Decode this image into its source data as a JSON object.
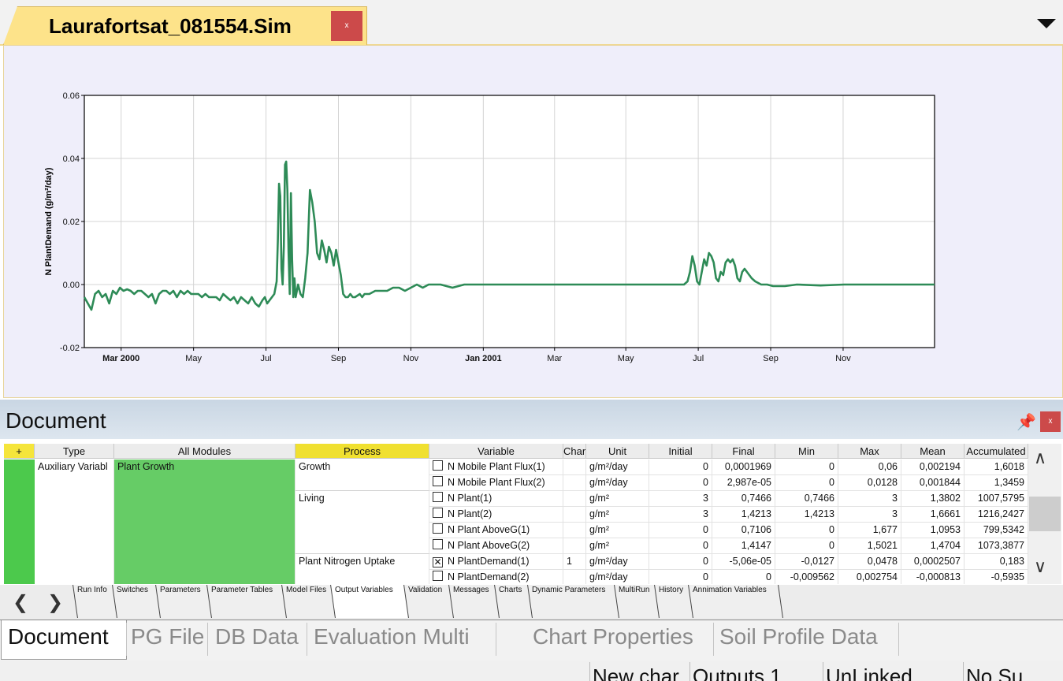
{
  "window": {
    "doc_tab_title": "Laurafortsat_081554.Sim",
    "close_glyph": "x"
  },
  "chart_data": {
    "type": "line",
    "title": "",
    "xlabel": "",
    "ylabel": "N PlantDemand (g/m²/day)",
    "ylim": [
      -0.02,
      0.06
    ],
    "yticks": [
      "-0.02",
      "0.00",
      "0.02",
      "0.04",
      "0.06"
    ],
    "xticks": [
      "Mar 2000",
      "May",
      "Jul",
      "Sep",
      "Nov",
      "Jan 2001",
      "Mar",
      "May",
      "Jul",
      "Sep",
      "Nov"
    ],
    "bold_xticks": [
      "Mar 2000",
      "Jan 2001"
    ],
    "x_range_days": [
      0,
      716
    ],
    "grid": true,
    "line_color": "#2e8b57",
    "series": [
      {
        "x_days": [
          0,
          3,
          6,
          9,
          12,
          15,
          18,
          21,
          24,
          27,
          30,
          33,
          36,
          39,
          42,
          45,
          48,
          51,
          54,
          57,
          60,
          63,
          66,
          69,
          72,
          75,
          78,
          81,
          84,
          87,
          90,
          93,
          96,
          99,
          102,
          105,
          108,
          111,
          114,
          117,
          120,
          123,
          126,
          129,
          132,
          135,
          138,
          141,
          144,
          147,
          150,
          152,
          154,
          156,
          158,
          160,
          162,
          163,
          164,
          165,
          166,
          167,
          168,
          169,
          170,
          171,
          172,
          173,
          174,
          175,
          176,
          177,
          178,
          180,
          182,
          184,
          186,
          188,
          190,
          192,
          194,
          196,
          198,
          200,
          202,
          204,
          206,
          208,
          210,
          212,
          214,
          216,
          218,
          220,
          222,
          224,
          226,
          228,
          230,
          232,
          234,
          236,
          240,
          245,
          250,
          255,
          260,
          265,
          270,
          275,
          280,
          285,
          290,
          295,
          300,
          310,
          320,
          330,
          340,
          350,
          360,
          370,
          380,
          390,
          400,
          410,
          420,
          430,
          440,
          450,
          460,
          470,
          480,
          490,
          500,
          505,
          508,
          510,
          512,
          514,
          516,
          518,
          520,
          522,
          524,
          526,
          528,
          530,
          532,
          534,
          536,
          538,
          540,
          542,
          544,
          546,
          548,
          550,
          552,
          554,
          556,
          558,
          560,
          562,
          565,
          570,
          575,
          580,
          590,
          600,
          620,
          640,
          660,
          680,
          700,
          716
        ],
        "y": [
          -0.004,
          -0.006,
          -0.008,
          -0.003,
          -0.002,
          -0.004,
          -0.003,
          -0.006,
          -0.002,
          -0.003,
          -0.001,
          -0.002,
          -0.0015,
          -0.002,
          -0.003,
          -0.002,
          -0.002,
          -0.003,
          -0.004,
          -0.003,
          -0.006,
          -0.003,
          -0.002,
          -0.002,
          -0.003,
          -0.002,
          -0.004,
          -0.002,
          -0.003,
          -0.002,
          -0.003,
          -0.003,
          -0.003,
          -0.004,
          -0.003,
          -0.004,
          -0.004,
          -0.004,
          -0.005,
          -0.003,
          -0.004,
          -0.005,
          -0.004,
          -0.006,
          -0.004,
          -0.005,
          -0.006,
          -0.004,
          -0.006,
          -0.007,
          -0.005,
          -0.004,
          -0.006,
          -0.005,
          -0.004,
          -0.003,
          0.001,
          0.014,
          0.032,
          0.028,
          0.005,
          0.0,
          0.012,
          0.038,
          0.039,
          0.03,
          0.01,
          -0.003,
          0.029,
          0.008,
          -0.004,
          0.002,
          -0.004,
          0.0,
          -0.003,
          -0.004,
          0.002,
          0.01,
          0.03,
          0.026,
          0.02,
          0.01,
          0.008,
          0.014,
          0.011,
          0.007,
          0.012,
          0.01,
          0.006,
          0.011,
          0.007,
          0.003,
          -0.003,
          -0.004,
          -0.004,
          -0.003,
          -0.004,
          -0.004,
          -0.0035,
          -0.003,
          -0.004,
          -0.003,
          -0.003,
          -0.002,
          -0.002,
          -0.002,
          -0.001,
          -0.001,
          -0.002,
          -0.001,
          0.0,
          -0.001,
          0.0,
          0.0,
          0.0,
          -0.001,
          0.0,
          0.0,
          0.0,
          0.0,
          0.0,
          0.0,
          0.0,
          0.0,
          0.0,
          0.0,
          0.0,
          0.0,
          0.0,
          0.0,
          0.0,
          0.0,
          0.0,
          0.0,
          0.0,
          0.0,
          0.001,
          0.004,
          0.009,
          0.006,
          0.001,
          0.0,
          0.004,
          0.008,
          0.006,
          0.01,
          0.009,
          0.007,
          0.002,
          0.001,
          0.004,
          0.003,
          0.007,
          0.008,
          0.007,
          0.008,
          0.006,
          0.002,
          0.001,
          0.004,
          0.005,
          0.004,
          0.003,
          0.002,
          0.001,
          0.0,
          0.0,
          -0.0005,
          -0.0005,
          0.0,
          -0.0003,
          0.0,
          0.0,
          0.0,
          0.0,
          0.0,
          0.0
        ]
      }
    ]
  },
  "document_panel": {
    "title": "Document",
    "pin_icon": "⮟",
    "close_glyph": "x"
  },
  "grid": {
    "headers": [
      "+",
      "Type",
      "All Modules",
      "Process",
      "Variable",
      "Char",
      "Unit",
      "Initial",
      "Final",
      "Min",
      "Max",
      "Mean",
      "Accumulated"
    ],
    "type_value": "Auxiliary Variabl",
    "module_value": "Plant Growth",
    "processes": [
      {
        "name": "Growth",
        "row": 0
      },
      {
        "name": "Living",
        "row": 2
      },
      {
        "name": "Plant Nitrogen Uptake",
        "row": 6
      }
    ],
    "rows": [
      {
        "checked": false,
        "variable": "N Mobile Plant Flux(1)",
        "char": "",
        "unit": "g/m²/day",
        "initial": "0",
        "final": "0,0001969",
        "min": "0",
        "max": "0,06",
        "mean": "0,002194",
        "accumulated": "1,6018"
      },
      {
        "checked": false,
        "variable": "N Mobile Plant Flux(2)",
        "char": "",
        "unit": "g/m²/day",
        "initial": "0",
        "final": "2,987e-05",
        "min": "0",
        "max": "0,0128",
        "mean": "0,001844",
        "accumulated": "1,3459"
      },
      {
        "checked": false,
        "variable": "N Plant(1)",
        "char": "",
        "unit": "g/m²",
        "initial": "3",
        "final": "0,7466",
        "min": "0,7466",
        "max": "3",
        "mean": "1,3802",
        "accumulated": "1007,5795"
      },
      {
        "checked": false,
        "variable": "N Plant(2)",
        "char": "",
        "unit": "g/m²",
        "initial": "3",
        "final": "1,4213",
        "min": "1,4213",
        "max": "3",
        "mean": "1,6661",
        "accumulated": "1216,2427"
      },
      {
        "checked": false,
        "variable": "N Plant AboveG(1)",
        "char": "",
        "unit": "g/m²",
        "initial": "0",
        "final": "0,7106",
        "min": "0",
        "max": "1,677",
        "mean": "1,0953",
        "accumulated": "799,5342"
      },
      {
        "checked": false,
        "variable": "N Plant AboveG(2)",
        "char": "",
        "unit": "g/m²",
        "initial": "0",
        "final": "1,4147",
        "min": "0",
        "max": "1,5021",
        "mean": "1,4704",
        "accumulated": "1073,3877"
      },
      {
        "checked": true,
        "variable": "N PlantDemand(1)",
        "char": "1",
        "unit": "g/m²/day",
        "initial": "0",
        "final": "-5,06e-05",
        "min": "-0,0127",
        "max": "0,0478",
        "mean": "0,0002507",
        "accumulated": "0,183"
      },
      {
        "checked": false,
        "variable": "N PlantDemand(2)",
        "char": "",
        "unit": "g/m²/day",
        "initial": "0",
        "final": "0",
        "min": "-0,009562",
        "max": "0,002754",
        "mean": "-0,000813",
        "accumulated": "-0,5935"
      }
    ]
  },
  "subtabs": [
    "Run Info",
    "Switches",
    "Parameters",
    "Parameter Tables",
    "Model Files",
    "Output Variables",
    "Validation",
    "Messages",
    "Charts",
    "Dynamic Parameters",
    "MultiRun",
    "History",
    "Annimation Variables"
  ],
  "subtabs_active": "Output Variables",
  "nav": {
    "left": "❮",
    "right": "❯"
  },
  "bottom_tabs": [
    "Document",
    "PG File",
    "DB Data",
    "Evaluation Multi",
    "Chart Properties",
    "Soil Profile Data"
  ],
  "status": [
    "New char",
    "Outputs 1",
    "UnLinked",
    "No Su"
  ],
  "scroll": {
    "up": "∧",
    "down": "∨"
  }
}
